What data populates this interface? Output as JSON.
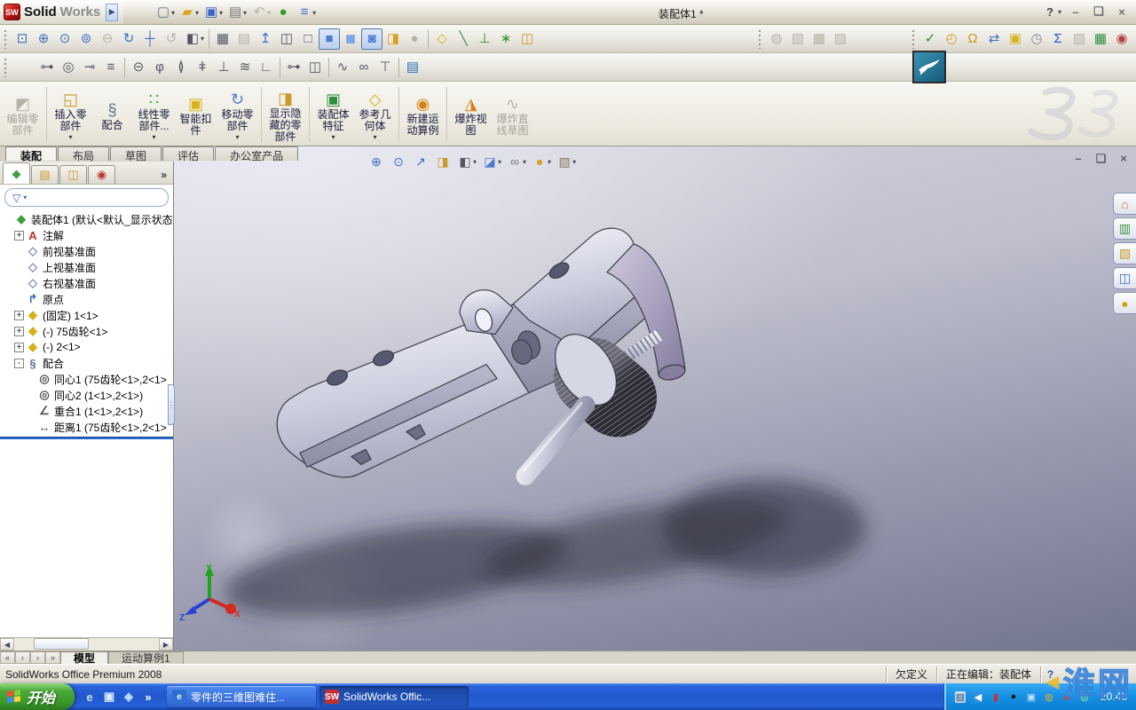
{
  "window": {
    "title": "装配体1 *",
    "brand_solid": "Solid",
    "brand_works": "Works",
    "brand_cube": "SW",
    "help": "?",
    "minimize": "–",
    "restore": "❏",
    "close": "×",
    "flyout": "▶"
  },
  "quick_access": [
    {
      "n": "new-document-button",
      "g": "▢",
      "c": "#667788",
      "dd": true
    },
    {
      "n": "open-document-button",
      "g": "▰",
      "c": "#d9a429",
      "dd": true
    },
    {
      "n": "save-button",
      "g": "▣",
      "c": "#3a62c8",
      "dd": true
    },
    {
      "n": "print-button",
      "g": "▤",
      "c": "#777777",
      "dd": true
    },
    {
      "n": "undo-button",
      "g": "↶",
      "c": "#9aa0aa",
      "dd": true,
      "cls": "disabled"
    },
    {
      "n": "select-traffic-light-button",
      "g": "●",
      "c": "#2aa02a"
    },
    {
      "n": "options-button",
      "g": "≡",
      "c": "#4a6fd4",
      "dd": true
    }
  ],
  "view_toolbar": {
    "nav": [
      {
        "n": "zoom-to-fit-button",
        "g": "⊡",
        "c": "#3c6ebf"
      },
      {
        "n": "zoom-to-area-button",
        "g": "⊕",
        "c": "#3c6ebf"
      },
      {
        "n": "zoom-in-out-button",
        "g": "⊙",
        "c": "#3c6ebf"
      },
      {
        "n": "zoom-to-selection-button",
        "g": "⊚",
        "c": "#3c6ebf"
      },
      {
        "n": "zoom-out-button",
        "g": "⊖",
        "c": "#3c6ebf",
        "cls": "disabled"
      },
      {
        "n": "rotate-view-button",
        "g": "↻",
        "c": "#3c6ebf"
      },
      {
        "n": "pan-button",
        "g": "┼",
        "c": "#3c6ebf"
      },
      {
        "n": "rotate-about-scene-floor-button",
        "g": "↺",
        "c": "#3c6ebf",
        "cls": "disabled"
      },
      {
        "n": "view-orientation-button",
        "g": "◧",
        "c": "#555566",
        "dd": true
      }
    ],
    "display": [
      {
        "n": "wireframe-button",
        "g": "▦",
        "c": "#555566"
      },
      {
        "n": "hidden-lines-visible-button",
        "g": "▤",
        "c": "#555566",
        "cls": "disabled"
      },
      {
        "n": "section-arrow-button",
        "g": "↥",
        "c": "#3c6ebf"
      },
      {
        "n": "hidden-lines-removed-button",
        "g": "◫",
        "c": "#555566"
      },
      {
        "n": "no-shade-cube-button",
        "g": "□",
        "c": "#555566"
      },
      {
        "n": "shaded-with-edges-button",
        "g": "■",
        "c": "#4a7bd0",
        "cls": "pressed"
      },
      {
        "n": "shaded-button",
        "g": "◼",
        "c": "#7fa8e8"
      },
      {
        "n": "shadows-in-shaded-mode-button",
        "g": "◙",
        "c": "#4a7bd0",
        "cls": "pressed"
      },
      {
        "n": "section-view-button",
        "g": "◨",
        "c": "#d8a020"
      },
      {
        "n": "realview-button",
        "g": "●",
        "c": "#9a9aa2",
        "cls": "disabled"
      }
    ],
    "reference": [
      {
        "n": "reference-plane-button",
        "g": "◇",
        "c": "#d8b018"
      },
      {
        "n": "reference-axis-button",
        "g": "╲",
        "c": "#3f8f3f"
      },
      {
        "n": "reference-coordinate-system-button",
        "g": "⊥",
        "c": "#2f8f2f"
      },
      {
        "n": "reference-point-button",
        "g": "∗",
        "c": "#2f8f2f"
      },
      {
        "n": "mate-reference-button",
        "g": "◫",
        "c": "#c89b2a"
      }
    ],
    "aux": [
      {
        "n": "assembly-transparency-button",
        "g": "◍",
        "c": "#b0aea4",
        "cls": "disabled"
      },
      {
        "n": "isolate-button",
        "g": "▧",
        "c": "#b0aea4",
        "cls": "disabled"
      },
      {
        "n": "large-assembly-mode-button",
        "g": "▩",
        "c": "#b0aea4",
        "cls": "disabled"
      },
      {
        "n": "assembly-visualization-button",
        "g": "▨",
        "c": "#b0aea4",
        "cls": "disabled"
      }
    ],
    "tools": [
      {
        "n": "spell-check-button",
        "g": "✓",
        "c": "#2a8a2a"
      },
      {
        "n": "measure-button",
        "g": "◴",
        "c": "#c8a020"
      },
      {
        "n": "mass-properties-button",
        "g": "Ω",
        "c": "#c8a020"
      },
      {
        "n": "move-face-button",
        "g": "⇄",
        "c": "#3c6ebf"
      },
      {
        "n": "design-checker-button",
        "g": "▣",
        "c": "#d8b018"
      },
      {
        "n": "task-scheduler-button",
        "g": "◷",
        "c": "#888890"
      },
      {
        "n": "equations-button",
        "g": "Σ",
        "c": "#2b4fc0"
      },
      {
        "n": "compare-documents-button",
        "g": "▨",
        "c": "#b0aea4",
        "cls": "disabled"
      },
      {
        "n": "design-table-button",
        "g": "▦",
        "c": "#2f8f3f"
      },
      {
        "n": "screen-capture-button",
        "g": "◉",
        "c": "#b04040"
      }
    ]
  },
  "toolbox_toolbar": {
    "t1": [
      {
        "n": "pan-head-screw-button",
        "g": "⊶",
        "c": "#555560"
      },
      {
        "n": "hex-nut-button",
        "g": "◎",
        "c": "#555560"
      },
      {
        "n": "set-screw-button",
        "g": "⊸",
        "c": "#555560"
      },
      {
        "n": "threaded-stud-button",
        "g": "≡",
        "c": "#555560"
      }
    ],
    "t2": [
      {
        "n": "slotted-hole-button",
        "g": "⊝",
        "c": "#555560"
      },
      {
        "n": "bolt-upright-button",
        "g": "φ",
        "c": "#555560"
      },
      {
        "n": "dowel-pin-button",
        "g": "≬",
        "c": "#555560"
      },
      {
        "n": "locating-pin-button",
        "g": "ǂ",
        "c": "#555560"
      },
      {
        "n": "rivet-button",
        "g": "⊥",
        "c": "#555560"
      },
      {
        "n": "spring-button",
        "g": "≋",
        "c": "#555560"
      },
      {
        "n": "bracket-button",
        "g": "∟",
        "c": "#555560"
      }
    ],
    "t3": [
      {
        "n": "cam-button",
        "g": "⊶",
        "c": "#555560"
      },
      {
        "n": "bearing-button",
        "g": "◫",
        "c": "#555560"
      }
    ],
    "t4": [
      {
        "n": "coil-spring-button",
        "g": "∿",
        "c": "#555560"
      },
      {
        "n": "chain-link-button",
        "g": "∞",
        "c": "#555560"
      },
      {
        "n": "weld-stud-button",
        "g": "⊤",
        "c": "#555560"
      }
    ],
    "t5": [
      {
        "n": "toolbox-settings-button",
        "g": "▤",
        "c": "#2f6fbf"
      }
    ]
  },
  "command_manager": {
    "g1": [
      {
        "n": "edit-component-button",
        "label": "编辑零部件",
        "ic": "◩",
        "icc": "#b0aea4",
        "cls": "disabled"
      }
    ],
    "g2": [
      {
        "n": "insert-component-button",
        "label": "插入零部件",
        "ic": "◱",
        "icc": "#c89b2a",
        "dd": true
      },
      {
        "n": "mate-button",
        "label": "配合",
        "ic": "§",
        "icc": "#5a6f8a"
      },
      {
        "n": "linear-component-pattern-button",
        "label": "线性零部件...",
        "ic": "∷",
        "icc": "#2f9f2f",
        "dd": true
      },
      {
        "n": "smart-fasteners-button",
        "label": "智能扣件",
        "ic": "▣",
        "icc": "#d8b018"
      },
      {
        "n": "move-component-button",
        "label": "移动零部件",
        "ic": "↻",
        "icc": "#4a7bd0",
        "dd": true
      }
    ],
    "g3": [
      {
        "n": "show-hidden-components-button",
        "label": "显示隐藏的零部件",
        "ic": "◨",
        "icc": "#c89b2a"
      }
    ],
    "g4": [
      {
        "n": "assembly-features-button",
        "label": "装配体特征",
        "ic": "▣",
        "icc": "#2f8f3f",
        "dd": true
      },
      {
        "n": "reference-geometry-button",
        "label": "参考几何体",
        "ic": "◇",
        "icc": "#d8b018",
        "dd": true
      }
    ],
    "g5": [
      {
        "n": "new-motion-study-button",
        "label": "新建运动算例",
        "ic": "◉",
        "icc": "#d88018"
      }
    ],
    "g6": [
      {
        "n": "exploded-view-button",
        "label": "爆炸视图",
        "ic": "◮",
        "icc": "#d88018"
      },
      {
        "n": "explode-line-sketch-button",
        "label": "爆炸直线草图",
        "ic": "∿",
        "icc": "#b0aea4",
        "cls": "disabled"
      }
    ]
  },
  "ribbon_tabs": [
    {
      "n": "tab-assembly",
      "label": "装配",
      "cls": "active"
    },
    {
      "n": "tab-layout",
      "label": "布局"
    },
    {
      "n": "tab-sketch",
      "label": "草图"
    },
    {
      "n": "tab-evaluate",
      "label": "评估"
    },
    {
      "n": "tab-office-products",
      "label": "办公室产品"
    }
  ],
  "feature_panel": {
    "tabs": [
      {
        "n": "featuremanager-tab",
        "g": "◆",
        "c": "#3f9f3f",
        "cls": "active"
      },
      {
        "n": "propertymanager-tab",
        "g": "▤",
        "c": "#c89b2a"
      },
      {
        "n": "configurationmanager-tab",
        "g": "◫",
        "c": "#c89b2a"
      },
      {
        "n": "dimxpert-tab",
        "g": "◉",
        "c": "#c23030"
      }
    ],
    "more": "»",
    "filter_glyph": "▽",
    "tree": [
      {
        "n": "tree-root-assembly",
        "ic": "◆",
        "icc": "#3f9f3f",
        "label": "装配体1 (默认<默认_显示状态",
        "ind": 0
      },
      {
        "n": "tree-annotations",
        "exp": "+",
        "ic": "A",
        "icc": "#c23030",
        "label": "注解",
        "ind": 1
      },
      {
        "n": "tree-front-plane",
        "ic": "◇",
        "icc": "#7a8ab0",
        "label": "前视基准面",
        "ind": 1
      },
      {
        "n": "tree-top-plane",
        "ic": "◇",
        "icc": "#7a8ab0",
        "label": "上视基准面",
        "ind": 1
      },
      {
        "n": "tree-right-plane",
        "ic": "◇",
        "icc": "#7a8ab0",
        "label": "右视基准面",
        "ind": 1
      },
      {
        "n": "tree-origin",
        "ic": "↱",
        "icc": "#3c6ebf",
        "label": "原点",
        "ind": 1
      },
      {
        "n": "tree-component-fixed-1",
        "exp": "+",
        "ic": "◆",
        "icc": "#d8b018",
        "label": "(固定) 1<1>",
        "ind": 1
      },
      {
        "n": "tree-component-75-gear",
        "exp": "+",
        "ic": "◆",
        "icc": "#d8b018",
        "label": "(-) 75齿轮<1>",
        "ind": 1
      },
      {
        "n": "tree-component-2",
        "exp": "+",
        "ic": "◆",
        "icc": "#d8b018",
        "label": "(-) 2<1>",
        "ind": 1
      },
      {
        "n": "tree-mates-folder",
        "exp": "-",
        "ic": "§",
        "icc": "#5a6f8a",
        "label": "配合",
        "ind": 1
      },
      {
        "n": "tree-mate-concentric-1",
        "ic": "◎",
        "icc": "#555555",
        "label": "同心1 (75齿轮<1>,2<1>",
        "ind": 2
      },
      {
        "n": "tree-mate-concentric-2",
        "ic": "◎",
        "icc": "#555555",
        "label": "同心2 (1<1>,2<1>)",
        "ind": 2
      },
      {
        "n": "tree-mate-coincident-1",
        "ic": "∠",
        "icc": "#555555",
        "label": "重合1 (1<1>,2<1>)",
        "ind": 2
      },
      {
        "n": "tree-mate-distance-1",
        "ic": "↔",
        "icc": "#555555",
        "label": "距离1 (75齿轮<1>,2<1>",
        "ind": 2
      }
    ]
  },
  "heads_up": [
    {
      "n": "hud-zoom-to-fit-button",
      "g": "⊕",
      "c": "#3c6ebf"
    },
    {
      "n": "hud-zoom-to-area-button",
      "g": "⊙",
      "c": "#3c6ebf"
    },
    {
      "n": "hud-previous-view-button",
      "g": "↗",
      "c": "#3c6ebf"
    },
    {
      "n": "hud-section-view-button",
      "g": "◨",
      "c": "#c89b2a"
    },
    {
      "n": "hud-view-orientation-button",
      "g": "◧",
      "c": "#555566",
      "dd": true
    },
    {
      "n": "hud-display-style-button",
      "g": "◪",
      "c": "#4a7bd0",
      "dd": true
    },
    {
      "n": "hud-hide-show-items-button",
      "g": "∞",
      "c": "#777780",
      "dd": true
    },
    {
      "n": "hud-edit-appearance-button",
      "g": "●",
      "c": "#d8a018",
      "dd": true
    },
    {
      "n": "hud-apply-scene-button",
      "g": "▧",
      "c": "#8a7a5a",
      "dd": true
    }
  ],
  "viewport_controls": {
    "minimize": "–",
    "restore": "❏",
    "close": "×"
  },
  "task_pane": [
    {
      "n": "solidworks-resources-tab",
      "g": "⌂",
      "c": "#c87818"
    },
    {
      "n": "design-library-tab",
      "g": "▥",
      "c": "#3f8f3f"
    },
    {
      "n": "file-explorer-tab",
      "g": "▧",
      "c": "#c89b2a"
    },
    {
      "n": "view-palette-tab",
      "g": "◫",
      "c": "#3c6ebf"
    },
    {
      "n": "appearances-tab",
      "g": "●",
      "c": "#d8a018"
    }
  ],
  "triad": {
    "x_label": "X",
    "y_label": "Y",
    "z_label": "Z",
    "x_color": "#d42a1e",
    "y_color": "#1fa51f",
    "z_color": "#2a3fd4"
  },
  "doc_bar": {
    "nav": [
      {
        "g": "«"
      },
      {
        "g": "‹"
      },
      {
        "g": "›"
      },
      {
        "g": "»"
      }
    ],
    "tabs": [
      {
        "n": "model-tab",
        "label": "模型",
        "cls": "active"
      },
      {
        "n": "motion-study-tab",
        "label": "运动算例1"
      }
    ]
  },
  "status_bar": {
    "product": "SolidWorks Office Premium 2008",
    "define_state": "欠定义",
    "editing": "正在编辑：装配体",
    "tip_icon": "?"
  },
  "taskbar": {
    "start_label": "开始",
    "quick_launch": [
      {
        "n": "quick-ie-icon",
        "g": "e",
        "c": "#bfe4ff"
      },
      {
        "n": "quick-show-desktop-icon",
        "g": "▣",
        "c": "#d8ecff"
      },
      {
        "n": "quick-messenger-icon",
        "g": "◈",
        "c": "#bfe0ff"
      },
      {
        "n": "quick-overflow-chevron",
        "g": "»",
        "c": "#ffffff"
      }
    ],
    "tasks": [
      {
        "n": "task-ie-browser",
        "g": "e",
        "c": "#eaf6ff",
        "bg": "#2f6fd0",
        "label": "零件的三维图难住..."
      },
      {
        "n": "task-solidworks",
        "g": "SW",
        "c": "#ffffff",
        "bg": "#c23030",
        "label": "SolidWorks Offic...",
        "cls": "active"
      }
    ],
    "tray": [
      {
        "n": "tray-keyboard-icon",
        "g": "▤",
        "c": "#20406a",
        "bg": "#cfe2f6"
      },
      {
        "n": "tray-language-collapse-icon",
        "g": "◀",
        "c": "#ffffff",
        "bg": "#2f8fe0"
      },
      {
        "n": "tray-av-icon",
        "g": "▮",
        "c": "#d03030"
      },
      {
        "n": "tray-qq-icon",
        "g": "●",
        "c": "#1a1a1a"
      },
      {
        "n": "tray-network-icon",
        "g": "▣",
        "c": "#bfe0ff"
      },
      {
        "n": "tray-qq2-icon",
        "g": "◍",
        "c": "#e8b030"
      },
      {
        "n": "tray-security-icon",
        "g": "▰",
        "c": "#d04040"
      },
      {
        "n": "tray-globe-icon",
        "g": "◍",
        "c": "#8fe09f"
      }
    ],
    "clock": "20:48"
  },
  "watermark": {
    "fish": "◀",
    "text": "淮网"
  }
}
